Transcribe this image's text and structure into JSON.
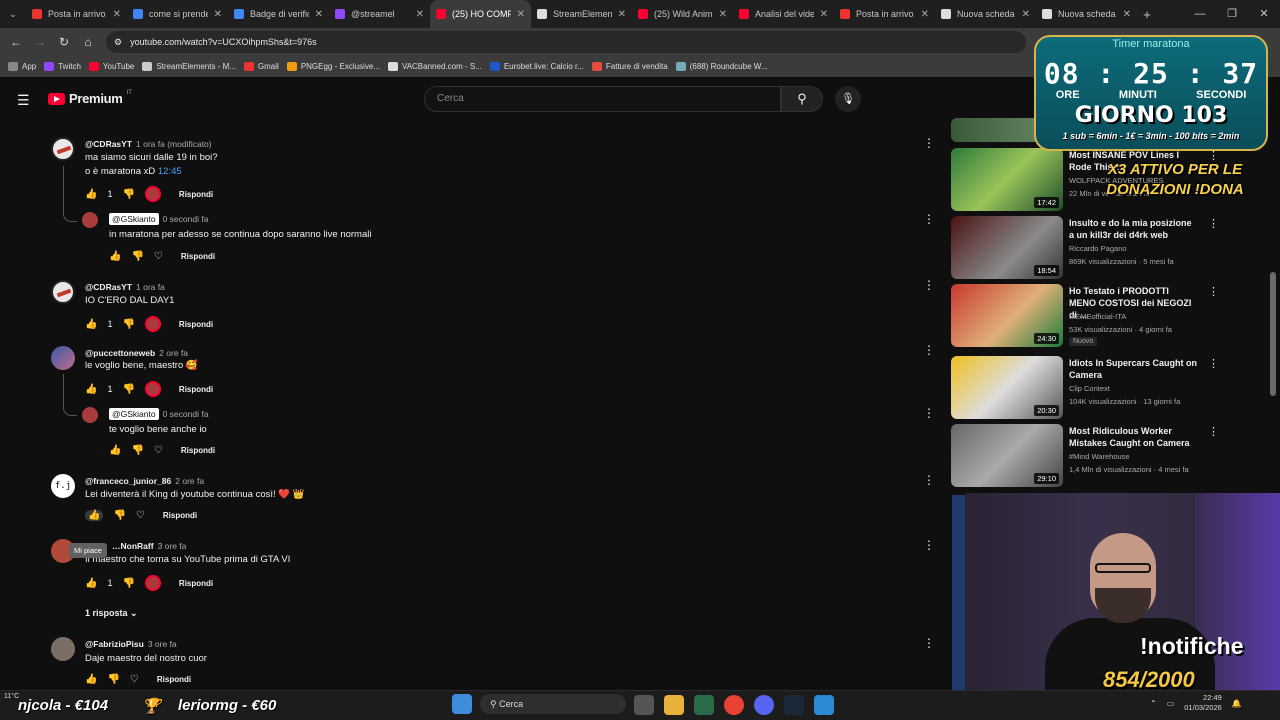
{
  "browser": {
    "tabs": [
      {
        "title": "Posta in arrivo",
        "fav": "#e33"
      },
      {
        "title": "come si prende",
        "fav": "#4285f4"
      },
      {
        "title": "Badge di verific",
        "fav": "#4285f4"
      },
      {
        "title": "@streamel",
        "fav": "#9146ff"
      },
      {
        "title": "(25) HO COMP",
        "fav": "#ff0033",
        "active": true
      },
      {
        "title": "StreamElemen",
        "fav": "#ddd"
      },
      {
        "title": "(25) Wild Anim",
        "fav": "#ff0033"
      },
      {
        "title": "Analisi del vide",
        "fav": "#ff0033"
      },
      {
        "title": "Posta in arrivo",
        "fav": "#e33"
      },
      {
        "title": "Nuova scheda",
        "fav": "#ddd"
      },
      {
        "title": "Nuova scheda",
        "fav": "#ddd"
      }
    ],
    "url": "youtube.com/watch?v=UCXOihpmShs&t=976s",
    "bookmarks": [
      "App",
      "Twitch",
      "YouTube",
      "StreamElements - M...",
      "Gmail",
      "PNGEgg - Exclusive...",
      "VACBanned.com - S...",
      "Eurobet.live: Calcio r...",
      "Fatture di vendita",
      "(688) Roundcube W..."
    ]
  },
  "header": {
    "logo": "Premium",
    "country": "IT",
    "search_placeholder": "Cerca"
  },
  "comments": [
    {
      "author": "@CDRasYT",
      "meta": "1 ora fa (modificato)",
      "lines": [
        "ma siamo sicuri dalle 19 in boi?",
        "o è maratona xD"
      ],
      "timestamp_link": "12:45",
      "likes": "1",
      "reply": "Rispondi"
    },
    {
      "author": "@GSkianto",
      "meta": "0 secondi fa",
      "text": "in maratona per adesso se continua dopo saranno live normali",
      "reply": "Rispondi"
    },
    {
      "author": "@CDRasYT",
      "meta": "1 ora fa",
      "text": "IO C'ERO DAL DAY1",
      "likes": "1",
      "reply": "Rispondi"
    },
    {
      "author": "@puccettoneweb",
      "meta": "2 ore fa",
      "text": "le voglio bene, maestro 🥰",
      "likes": "1",
      "reply": "Rispondi"
    },
    {
      "author": "@GSkianto",
      "meta": "0 secondi fa",
      "text": "te voglio bene anche io",
      "reply": "Rispondi"
    },
    {
      "author": "@franceco_junior_86",
      "meta": "2 ore fa",
      "text": "Lei diventerà il  King di youtube continua così! ❤️ 👑",
      "reply": "Rispondi",
      "avatar_letters": "f.j"
    },
    {
      "author": "…NonRaff",
      "meta": "3 ore fa",
      "text": "Il maestro che torna su YouTube prima di GTA VI",
      "likes": "1",
      "reply": "Rispondi"
    },
    {
      "author": "@FabrizioPisu",
      "meta": "3 ore fa",
      "text": "Daje maestro del nostro cuor",
      "reply": "Rispondi"
    }
  ],
  "replies_toggle": "1 risposta",
  "tooltip": "Mi piace",
  "sidebar": [
    {
      "title": "Most INSANE POV Lines I Rode This Y...",
      "channel": "WOLFPACK ADVENTURES",
      "meta": "22 Mln di visualizzazioni",
      "duration": "17:42",
      "thumb": "linear-gradient(135deg,#2e7a3a,#9bc45a 50%,#1f4d2a)"
    },
    {
      "title": "Insulto e do la mia posizione a un kill3r dei d4rk web",
      "channel": "Riccardo Pagano",
      "meta": "869K visualizzazioni · 5 mesi fa",
      "duration": "18:54",
      "thumb": "linear-gradient(135deg,#4a1212,#8b8b8b 60%,#333)"
    },
    {
      "title": "Ho Testato i PRODOTTI MENO COSTOSI dei NEGOZI di ...",
      "channel": "MEMEofficial-ITA",
      "meta": "53K visualizzazioni · 4 giorni fa",
      "badge": "Nuovo",
      "duration": "24:30",
      "thumb": "linear-gradient(135deg,#c8382e,#e0b07a 55%,#1a7a3a)"
    },
    {
      "title": "Idiots In Supercars Caught on Camera",
      "channel": "Clip Context",
      "meta": "104K visualizzazioni · 13 giorni fa",
      "duration": "20:30",
      "thumb": "linear-gradient(135deg,#f0c020,#ddd 50%,#555)"
    },
    {
      "title": "Most Ridiculous Worker Mistakes Caught on Camera",
      "channel": "#Mind Warehouse",
      "meta": "1,4 Mln di visualizzazioni · 4 mesi fa",
      "duration": "29:10",
      "thumb": "linear-gradient(135deg,#666,#aaa 50%,#444)"
    }
  ],
  "overlay": {
    "timer_title": "Timer maratona",
    "timer_value": "08 : 25 : 37",
    "units": [
      "ORE",
      "MINUTI",
      "SECONDI"
    ],
    "day": "GIORNO 103",
    "rate": "1 sub = 6min - 1€ = 3min - 100 bits = 2min",
    "x3": "X3 ATTIVO PER LE DONAZIONI !DONA",
    "notifiche": "!notifiche",
    "subcount": "854/2000",
    "donations": [
      "njcola - €104",
      "leriormg - €60"
    ]
  },
  "taskbar": {
    "temp": "11°C",
    "search": "Cerca",
    "time": "22:49",
    "date": "01/03/2026"
  }
}
